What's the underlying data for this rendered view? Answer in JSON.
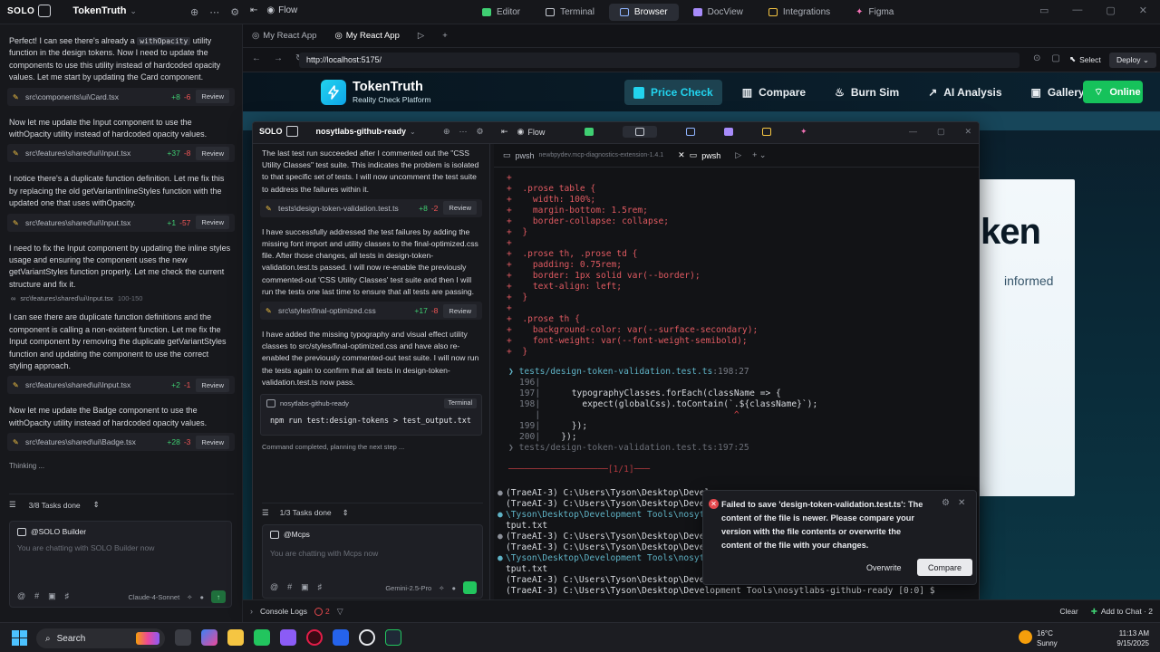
{
  "topbar": {
    "brand_label": "SOLO",
    "project_name": "TokenTruth",
    "tabs": [
      {
        "label": "Editor",
        "color": "#3fcf72"
      },
      {
        "label": "Terminal",
        "color": "#c7cbd3"
      },
      {
        "label": "Browser",
        "color": "#8fb4ff"
      },
      {
        "label": "DocView",
        "color": "#a78bfa"
      },
      {
        "label": "Integrations",
        "color": "#f5c542"
      },
      {
        "label": "Figma",
        "color": "#f472b6"
      }
    ],
    "flow_label": "Flow"
  },
  "left_panel": {
    "messages": [
      {
        "pre": "Perfect! I can see there's already a ",
        "code": "withOpacity",
        "post": " utility function in the design tokens. Now I need to update the components to use this utility instead of hardcoded opacity values. Let me start by updating the Card component."
      },
      {
        "text": "Now let me update the Input component to use the withOpacity utility instead of hardcoded opacity values."
      },
      {
        "text": "I notice there's a duplicate function definition. Let me fix this by replacing the old getVariantInlineStyles function with the updated one that uses withOpacity."
      },
      {
        "text": "I need to fix the Input component by updating the inline styles usage and ensuring the component uses the new getVariantStyles function properly. Let me check the current structure and fix it."
      },
      {
        "text": "I can see there are duplicate function definitions and the component is calling a non-existent function. Let me fix the Input component by removing the duplicate getVariantStyles function and updating the component to use the correct styling approach."
      },
      {
        "text": "Now let me update the Badge component to use the withOpacity utility instead of hardcoded opacity values."
      }
    ],
    "files": [
      {
        "path": "src\\components\\ui\\Card.tsx",
        "add": "+8",
        "del": "-6",
        "review": "Review"
      },
      {
        "path": "src\\features\\shared\\ui\\Input.tsx",
        "add": "+37",
        "del": "-8",
        "review": "Review"
      },
      {
        "path": "src\\features\\shared\\ui\\Input.tsx",
        "add": "+1",
        "del": "-57",
        "review": "Review"
      },
      {
        "path": "src\\features\\shared\\ui\\Input.tsx",
        "add": "+2",
        "del": "-1",
        "review": "Review"
      },
      {
        "path": "src\\features\\shared\\ui\\Badge.tsx",
        "add": "+28",
        "del": "-3",
        "review": "Review"
      }
    ],
    "read_ref": {
      "path": "src\\features\\shared\\ui\\Input.tsx",
      "range": "100-150"
    },
    "thinking": "Thinking ...",
    "tasks": "3/8 Tasks done",
    "chat_agent": "@SOLO Builder",
    "chat_placeholder": "You are chatting with SOLO Builder now",
    "model": "Claude-4-Sonnet"
  },
  "browser": {
    "tabs": [
      {
        "label": "My React App"
      },
      {
        "label": "My React App"
      }
    ],
    "url": "http://localhost:5175/",
    "select_label": "Select",
    "deploy_label": "Deploy",
    "app": {
      "title": "TokenTruth",
      "subtitle": "Reality Check Platform",
      "nav": [
        "Price Check",
        "Compare",
        "Burn Sim",
        "AI Analysis",
        "Gallery"
      ],
      "online": "Online",
      "hero_partial": "ken",
      "hero_sub_partial": "informed"
    }
  },
  "solo_window": {
    "brand": "SOLO",
    "project": "nosytlabs-github-ready",
    "flow": "Flow",
    "messages": [
      {
        "text": "The last test run succeeded after I commented out the \"CSS Utility Classes\" test suite. This indicates the problem is isolated to that specific set of tests. I will now uncomment the test suite to address the failures within it."
      },
      {
        "text": "I have successfully addressed the test failures by adding the missing font import and utility classes to the final-optimized.css file. After those changes, all tests in design-token-validation.test.ts passed. I will now re-enable the previously commented-out 'CSS Utility Classes' test suite and then I will run the tests one last time to ensure that all tests are passing."
      },
      {
        "text": "I have added the missing typography and visual effect utility classes to src/styles/final-optimized.css and have also re-enabled the previously commented-out test suite. I will now run the tests again to confirm that all tests in design-token-validation.test.ts now pass."
      }
    ],
    "files": [
      {
        "path": "tests\\design-token-validation.test.ts",
        "add": "+8",
        "del": "-2",
        "review": "Review"
      },
      {
        "path": "src\\styles\\final-optimized.css",
        "add": "+17",
        "del": "-8",
        "review": "Review"
      }
    ],
    "terminal_card": {
      "name": "nosytlabs-github-ready",
      "badge": "Terminal",
      "command": "npm run test:design-tokens > test_output.txt"
    },
    "status": "Command completed, planning the next step ...",
    "tasks": "1/3 Tasks done",
    "chat_agent": "@Mcps",
    "chat_placeholder": "You are chatting with Mcps now",
    "model": "Gemini-2.5-Pro"
  },
  "terminal": {
    "tabs": [
      {
        "label": "pwsh",
        "sub": "newbpydev.mcp-diagnostics-extension-1.4.1"
      },
      {
        "label": "pwsh"
      }
    ],
    "code_lines": [
      "+",
      "+  .prose table {",
      "+    width: 100%;",
      "+    margin-bottom: 1.5rem;",
      "+    border-collapse: collapse;",
      "+  }",
      "+",
      "+  .prose th, .prose td {",
      "+    padding: 0.75rem;",
      "+    border: 1px solid var(--border);",
      "+    text-align: left;",
      "+  }",
      "+",
      "+  .prose th {",
      "+    background-color: var(--surface-secondary);",
      "+    font-weight: var(--font-weight-semibold);",
      "+  }"
    ],
    "ref_file": "tests/design-token-validation.test.ts",
    "ref_loc": ":198:27",
    "ref_lines": [
      {
        "num": "196|",
        "text": ""
      },
      {
        "num": "197|",
        "text": "      typographyClasses.forEach(className => {"
      },
      {
        "num": "198|",
        "text": "        expect(globalCss).toContain(`.${className}`);"
      },
      {
        "num": "   |",
        "text": "                                     ^"
      },
      {
        "num": "199|",
        "text": "      });"
      },
      {
        "num": "200|",
        "text": "    });"
      }
    ],
    "ref_file2": "tests/design-token-validation.test.ts",
    "ref_loc2": ":197:25",
    "counter": "[1/1]",
    "prompt_lines": [
      "(TraeAI-3) C:\\Users\\Tyson\\Desktop\\Develop",
      "(TraeAI-3) C:\\Users\\Tyson\\Desktop\\Develop",
      "\\Tyson\\Desktop\\Development Tools\\nosytl",
      "tput.txt",
      "(TraeAI-3) C:\\Users\\Tyson\\Desktop\\Develop",
      "(TraeAI-3) C:\\Users\\Tyson\\Desktop\\Develop",
      "\\Tyson\\Desktop\\Development Tools\\nosytl",
      "tput.txt",
      "(TraeAI-3) C:\\Users\\Tyson\\Desktop\\Develop",
      "(TraeAI-3) C:\\Users\\Tyson\\Desktop\\Development Tools\\nosytlabs-github-ready [0:0] $"
    ]
  },
  "toast": {
    "message": "Failed to save 'design-token-validation.test.ts': The content of the file is newer. Please compare your version with the file contents or overwrite the content of the file with your changes.",
    "overwrite": "Overwrite",
    "compare": "Compare"
  },
  "console": {
    "label": "Console Logs",
    "count": "2",
    "clear": "Clear",
    "add_to_chat": "Add to Chat · 2"
  },
  "taskbar": {
    "search": "Search",
    "weather_temp": "16°C",
    "weather_desc": "Sunny",
    "time": "11:13 AM",
    "date": "9/15/2025"
  }
}
